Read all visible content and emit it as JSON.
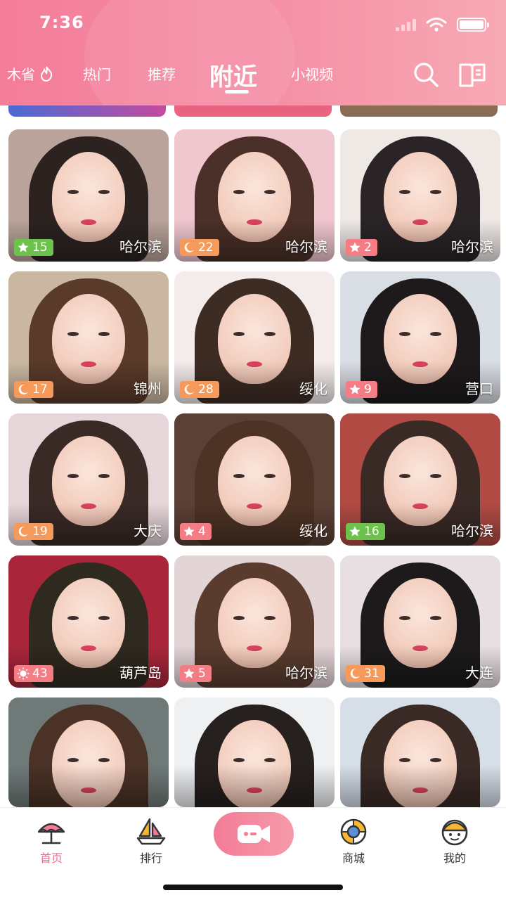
{
  "status_bar": {
    "time": "7:36"
  },
  "header": {
    "tabs": [
      {
        "label": "木省",
        "icon": "flame-icon"
      },
      {
        "label": "热门"
      },
      {
        "label": "推荐"
      },
      {
        "label": "附近",
        "active": true
      },
      {
        "label": "小视频"
      }
    ],
    "icons": [
      "search-icon",
      "bulletin-icon"
    ]
  },
  "cards": [
    {
      "badge_icon": "star-icon",
      "badge_value": "15",
      "badge_color": "#6cc24a",
      "city": "哈尔滨"
    },
    {
      "badge_icon": "moon-icon",
      "badge_value": "22",
      "badge_color": "#f59a5b",
      "city": "哈尔滨"
    },
    {
      "badge_icon": "star-icon",
      "badge_value": "2",
      "badge_color": "#f47c85",
      "city": "哈尔滨"
    },
    {
      "badge_icon": "moon-icon",
      "badge_value": "17",
      "badge_color": "#f59a5b",
      "city": "锦州"
    },
    {
      "badge_icon": "moon-icon",
      "badge_value": "28",
      "badge_color": "#f59a5b",
      "city": "绥化"
    },
    {
      "badge_icon": "star-icon",
      "badge_value": "9",
      "badge_color": "#f47c85",
      "city": "营口"
    },
    {
      "badge_icon": "moon-icon",
      "badge_value": "19",
      "badge_color": "#f59a5b",
      "city": "大庆"
    },
    {
      "badge_icon": "star-icon",
      "badge_value": "4",
      "badge_color": "#f47c85",
      "city": "绥化"
    },
    {
      "badge_icon": "star-icon",
      "badge_value": "16",
      "badge_color": "#6cc24a",
      "city": "哈尔滨"
    },
    {
      "badge_icon": "sun-icon",
      "badge_value": "43",
      "badge_color": "#f47c85",
      "city": "葫芦岛"
    },
    {
      "badge_icon": "star-icon",
      "badge_value": "5",
      "badge_color": "#f47c85",
      "city": "哈尔滨"
    },
    {
      "badge_icon": "moon-icon",
      "badge_value": "31",
      "badge_color": "#f59a5b",
      "city": "大连"
    },
    {
      "city": ""
    },
    {
      "city": ""
    },
    {
      "city": ""
    }
  ],
  "bottom_nav": [
    {
      "label": "首页",
      "icon": "home-umbrella-icon",
      "active": true
    },
    {
      "label": "排行",
      "icon": "ranking-boat-icon"
    },
    {
      "label": "",
      "icon": "live-camera-icon"
    },
    {
      "label": "商城",
      "icon": "mall-lifebuoy-icon"
    },
    {
      "label": "我的",
      "icon": "profile-face-icon"
    }
  ],
  "colors": {
    "accent": "#f06a8e",
    "header_start": "#f47d9a",
    "header_end": "#f7a9b4"
  }
}
